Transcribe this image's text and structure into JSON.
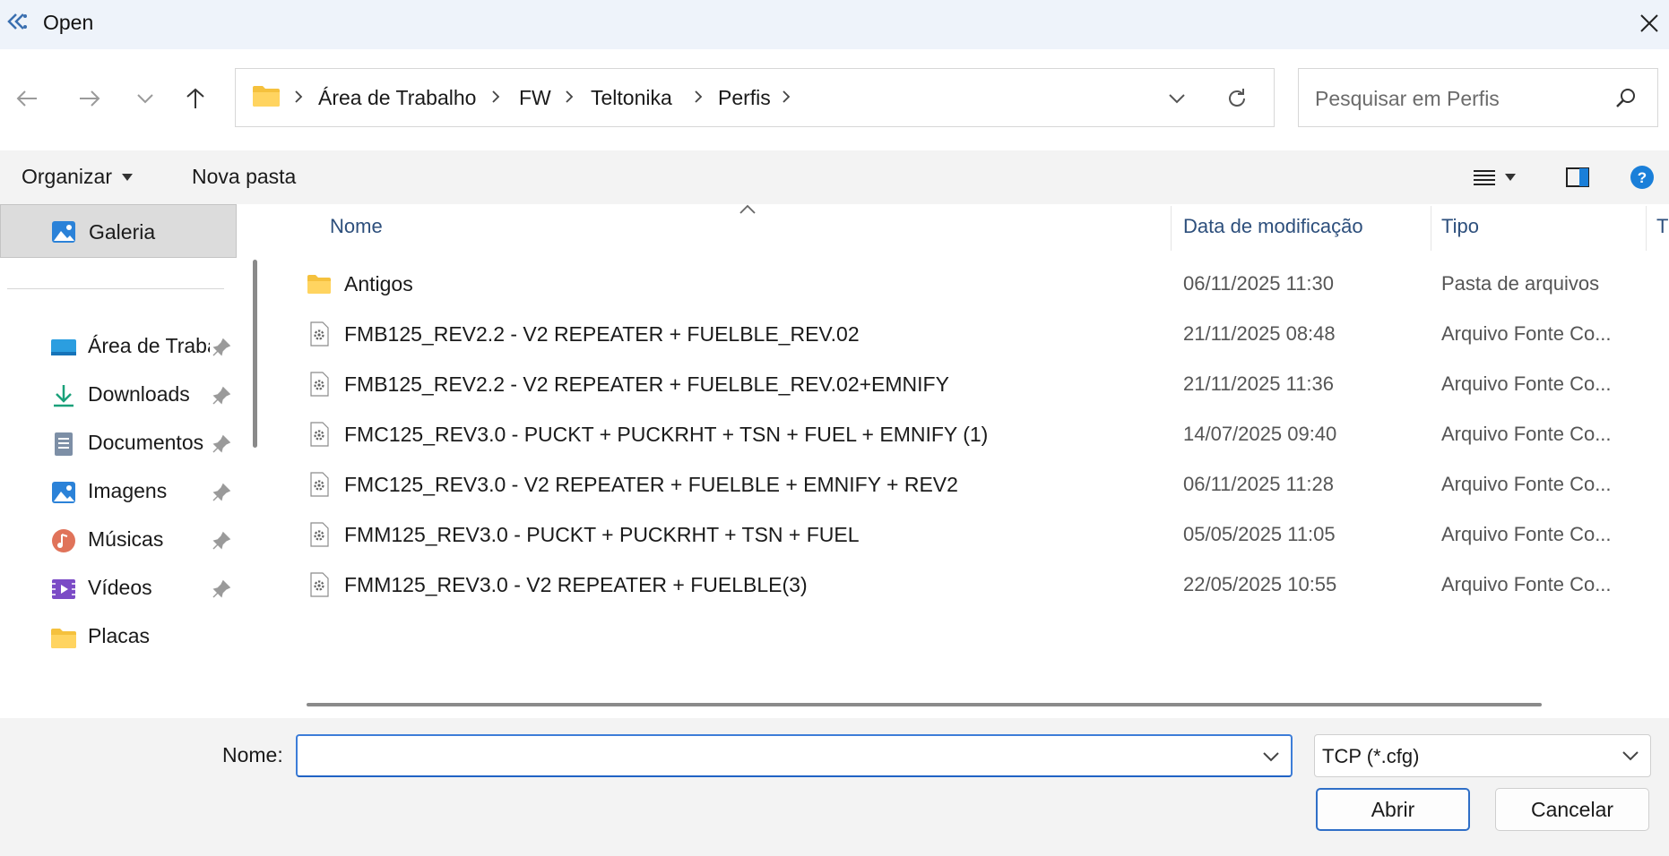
{
  "window": {
    "title": "Open"
  },
  "address": {
    "crumbs": [
      "Área de Trabalho",
      "FW",
      "Teltonika",
      "Perfis"
    ]
  },
  "search": {
    "placeholder": "Pesquisar em Perfis"
  },
  "toolbar": {
    "organize_label": "Organizar",
    "new_folder_label": "Nova pasta"
  },
  "sidebar": {
    "gallery": "Galeria",
    "items": [
      {
        "label": "Área de Trabalho",
        "icon": "desktop-icon",
        "pinned": true
      },
      {
        "label": "Downloads",
        "icon": "download-icon",
        "pinned": true
      },
      {
        "label": "Documentos",
        "icon": "documents-icon",
        "pinned": true
      },
      {
        "label": "Imagens",
        "icon": "pictures-icon",
        "pinned": true
      },
      {
        "label": "Músicas",
        "icon": "music-icon",
        "pinned": true
      },
      {
        "label": "Vídeos",
        "icon": "videos-icon",
        "pinned": true
      },
      {
        "label": "Placas",
        "icon": "folder-icon",
        "pinned": false
      }
    ]
  },
  "filelist": {
    "columns": {
      "name": "Nome",
      "date": "Data de modificação",
      "type": "Tipo",
      "size": "T"
    },
    "rows": [
      {
        "name": "Antigos",
        "date": "06/11/2025 11:30",
        "type": "Pasta de arquivos",
        "icon": "folder-icon"
      },
      {
        "name": "FMB125_REV2.2 - V2 REPEATER + FUELBLE_REV.02",
        "date": "21/11/2025 08:48",
        "type": "Arquivo Fonte Co...",
        "icon": "config-file-icon"
      },
      {
        "name": "FMB125_REV2.2 - V2 REPEATER + FUELBLE_REV.02+EMNIFY",
        "date": "21/11/2025 11:36",
        "type": "Arquivo Fonte Co...",
        "icon": "config-file-icon"
      },
      {
        "name": "FMC125_REV3.0 - PUCKT + PUCKRHT + TSN + FUEL + EMNIFY (1)",
        "date": "14/07/2025 09:40",
        "type": "Arquivo Fonte Co...",
        "icon": "config-file-icon"
      },
      {
        "name": "FMC125_REV3.0 - V2 REPEATER + FUELBLE + EMNIFY + REV2",
        "date": "06/11/2025 11:28",
        "type": "Arquivo Fonte Co...",
        "icon": "config-file-icon"
      },
      {
        "name": "FMM125_REV3.0 - PUCKT + PUCKRHT + TSN + FUEL",
        "date": "05/05/2025 11:05",
        "type": "Arquivo Fonte Co...",
        "icon": "config-file-icon"
      },
      {
        "name": "FMM125_REV3.0 - V2 REPEATER + FUELBLE(3)",
        "date": "22/05/2025 10:55",
        "type": "Arquivo Fonte Co...",
        "icon": "config-file-icon"
      }
    ]
  },
  "bottom": {
    "name_label": "Nome:",
    "name_value": "",
    "filter": "TCP (*.cfg)",
    "open_label": "Abrir",
    "cancel_label": "Cancelar"
  },
  "colors": {
    "accent": "#2f6fc7",
    "header_text": "#2d4f7c",
    "folder": "#f5c13d",
    "help": "#1a7fd9"
  }
}
